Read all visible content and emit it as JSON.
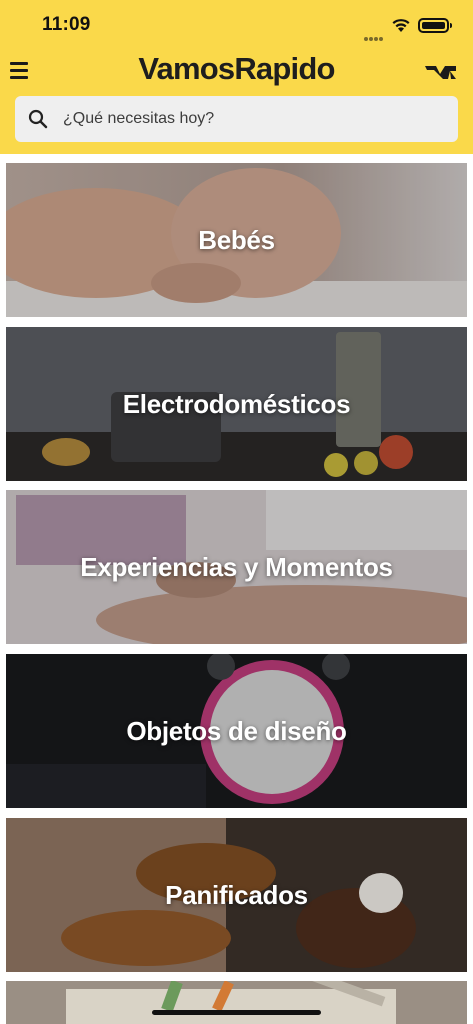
{
  "status_bar": {
    "time": "11:09"
  },
  "header": {
    "app_title": "VamosRapido",
    "brand_icon": "vr-logo-icon",
    "menu_icon": "hamburger-icon"
  },
  "search": {
    "placeholder": "¿Qué necesitas hoy?",
    "value": ""
  },
  "categories": [
    {
      "label": "Bebés"
    },
    {
      "label": "Electrodomésticos"
    },
    {
      "label": "Experiencias y Momentos"
    },
    {
      "label": "Objetos de diseño"
    },
    {
      "label": "Panificados"
    },
    {
      "label": ""
    }
  ],
  "colors": {
    "accent": "#fad94a",
    "search_bg": "#efefef"
  }
}
